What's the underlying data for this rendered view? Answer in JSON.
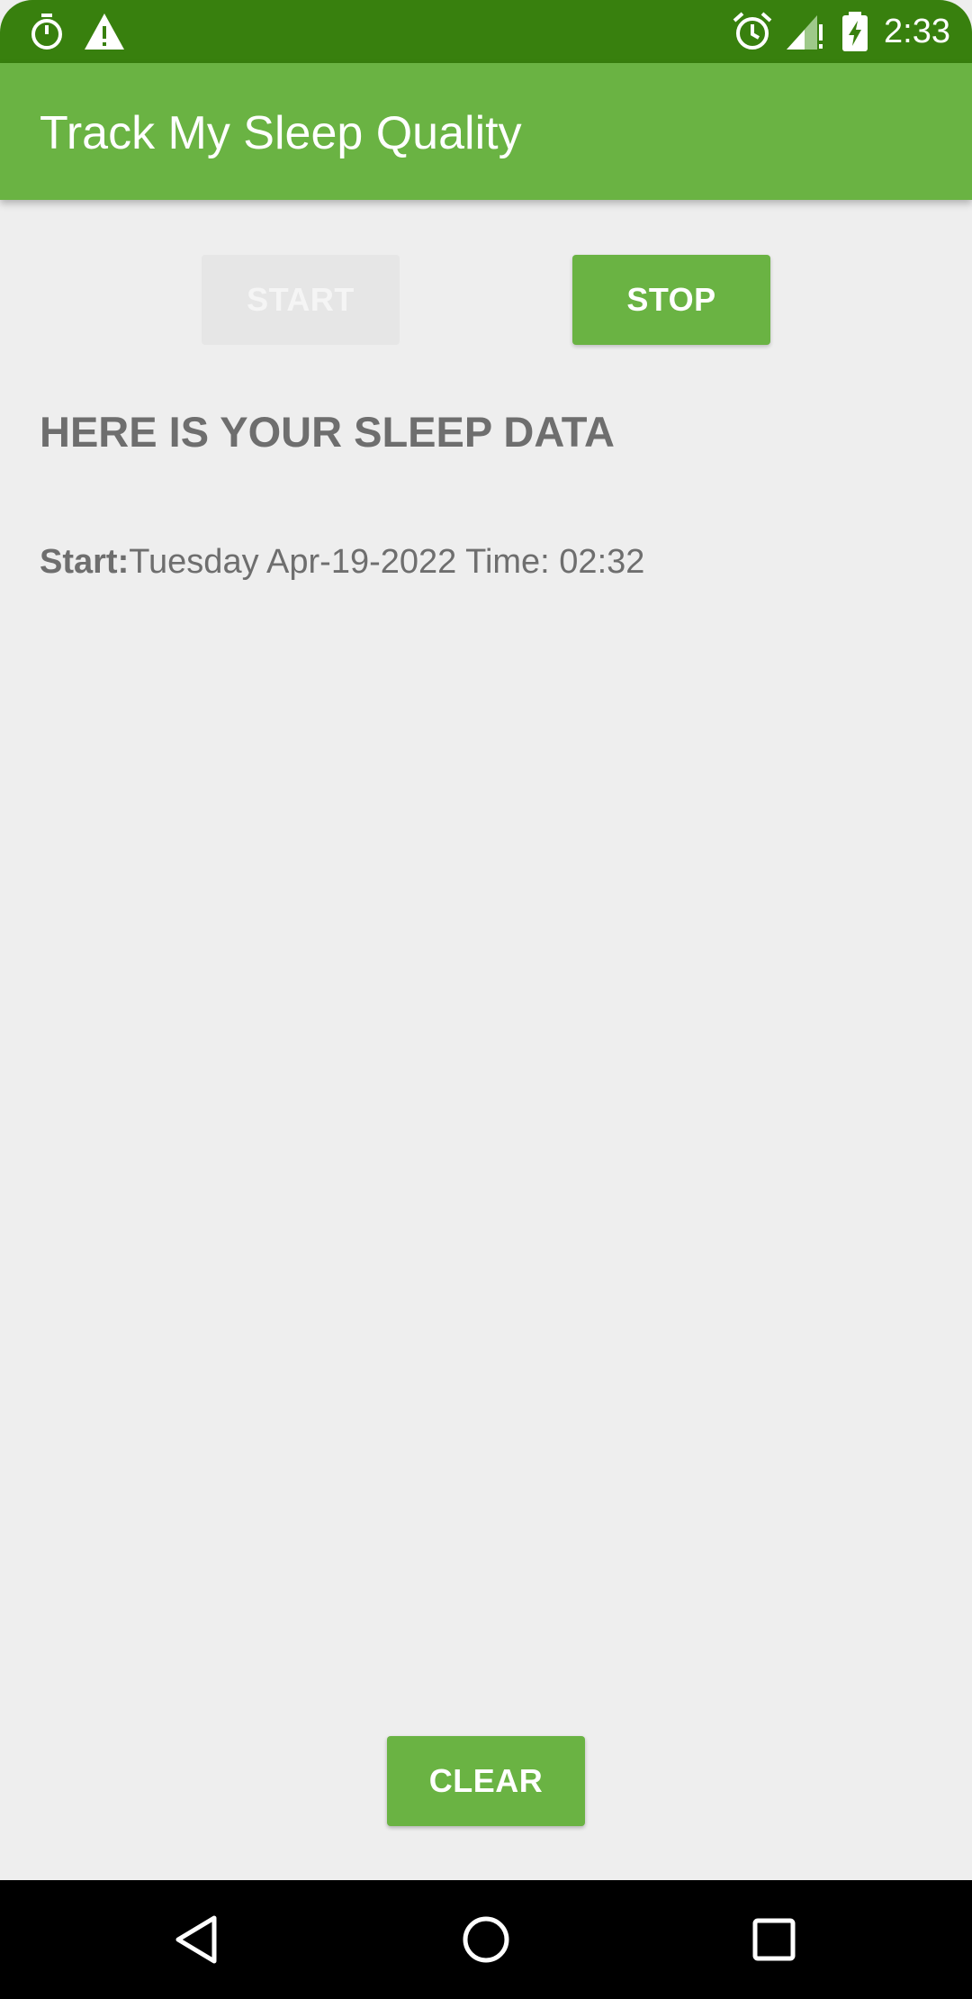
{
  "status_bar": {
    "time": "2:33",
    "left_icons": [
      "stopwatch-icon",
      "warning-icon"
    ],
    "right_icons": [
      "alarm-icon",
      "signal-icon",
      "battery-charging-icon"
    ],
    "background": "#38800e"
  },
  "app_bar": {
    "title": "Track My Sleep Quality",
    "background": "#6ab343"
  },
  "controls": {
    "start_label": "START",
    "start_enabled": false,
    "stop_label": "STOP",
    "stop_enabled": true
  },
  "content": {
    "heading": "HERE IS YOUR SLEEP DATA",
    "entry_label": "Start:",
    "entry_value": "Tuesday Apr-19-2022 Time: 02:32"
  },
  "footer": {
    "clear_label": "CLEAR"
  },
  "navigation": {
    "icons": [
      "back-icon",
      "home-icon",
      "recents-icon"
    ]
  }
}
